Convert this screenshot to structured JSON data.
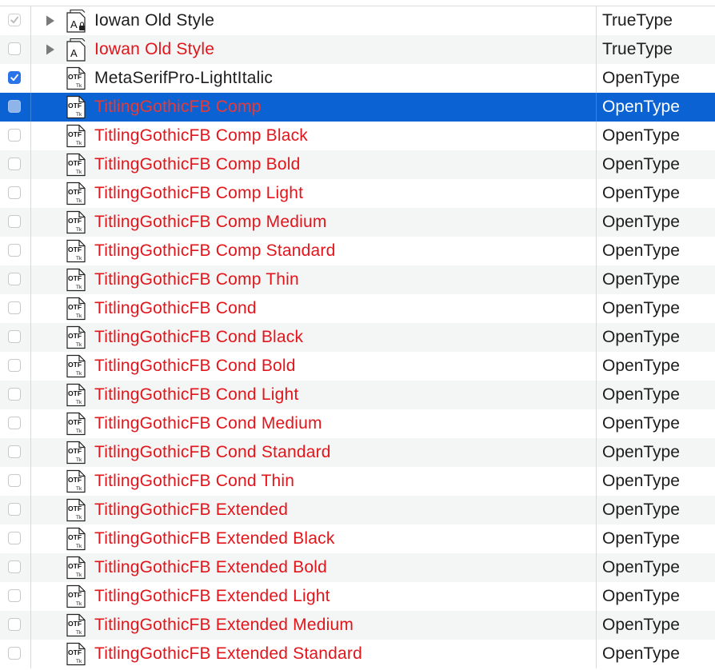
{
  "colors": {
    "missing_font_text": "#e2151b",
    "normal_text": "#1d1d1d",
    "selection": "#0b63d3",
    "checkbox_checked": "#2a73e8",
    "row_alternate": "#f4f5f5"
  },
  "rows": [
    {
      "name": "Iowan Old Style",
      "kind": "TrueType",
      "name_color": "black",
      "checkbox": "checked-disabled",
      "icon": "font-collection-locked-icon",
      "disclosure": true,
      "selected": false
    },
    {
      "name": "Iowan Old Style",
      "kind": "TrueType",
      "name_color": "red",
      "checkbox": "unchecked",
      "icon": "font-collection-icon",
      "disclosure": true,
      "selected": false
    },
    {
      "name": "MetaSerifPro-LightItalic",
      "kind": "OpenType",
      "name_color": "black",
      "checkbox": "checked",
      "icon": "otf-file-icon",
      "disclosure": false,
      "selected": false
    },
    {
      "name": "TitlingGothicFB Comp",
      "kind": "OpenType",
      "name_color": "red",
      "checkbox": "selected",
      "icon": "otf-file-icon",
      "disclosure": false,
      "selected": true
    },
    {
      "name": "TitlingGothicFB Comp Black",
      "kind": "OpenType",
      "name_color": "red",
      "checkbox": "unchecked",
      "icon": "otf-file-icon",
      "disclosure": false,
      "selected": false
    },
    {
      "name": "TitlingGothicFB Comp Bold",
      "kind": "OpenType",
      "name_color": "red",
      "checkbox": "unchecked",
      "icon": "otf-file-icon",
      "disclosure": false,
      "selected": false
    },
    {
      "name": "TitlingGothicFB Comp Light",
      "kind": "OpenType",
      "name_color": "red",
      "checkbox": "unchecked",
      "icon": "otf-file-icon",
      "disclosure": false,
      "selected": false
    },
    {
      "name": "TitlingGothicFB Comp Medium",
      "kind": "OpenType",
      "name_color": "red",
      "checkbox": "unchecked",
      "icon": "otf-file-icon",
      "disclosure": false,
      "selected": false
    },
    {
      "name": "TitlingGothicFB Comp Standard",
      "kind": "OpenType",
      "name_color": "red",
      "checkbox": "unchecked",
      "icon": "otf-file-icon",
      "disclosure": false,
      "selected": false
    },
    {
      "name": "TitlingGothicFB Comp Thin",
      "kind": "OpenType",
      "name_color": "red",
      "checkbox": "unchecked",
      "icon": "otf-file-icon",
      "disclosure": false,
      "selected": false
    },
    {
      "name": "TitlingGothicFB Cond",
      "kind": "OpenType",
      "name_color": "red",
      "checkbox": "unchecked",
      "icon": "otf-file-icon",
      "disclosure": false,
      "selected": false
    },
    {
      "name": "TitlingGothicFB Cond Black",
      "kind": "OpenType",
      "name_color": "red",
      "checkbox": "unchecked",
      "icon": "otf-file-icon",
      "disclosure": false,
      "selected": false
    },
    {
      "name": "TitlingGothicFB Cond Bold",
      "kind": "OpenType",
      "name_color": "red",
      "checkbox": "unchecked",
      "icon": "otf-file-icon",
      "disclosure": false,
      "selected": false
    },
    {
      "name": "TitlingGothicFB Cond Light",
      "kind": "OpenType",
      "name_color": "red",
      "checkbox": "unchecked",
      "icon": "otf-file-icon",
      "disclosure": false,
      "selected": false
    },
    {
      "name": "TitlingGothicFB Cond Medium",
      "kind": "OpenType",
      "name_color": "red",
      "checkbox": "unchecked",
      "icon": "otf-file-icon",
      "disclosure": false,
      "selected": false
    },
    {
      "name": "TitlingGothicFB Cond Standard",
      "kind": "OpenType",
      "name_color": "red",
      "checkbox": "unchecked",
      "icon": "otf-file-icon",
      "disclosure": false,
      "selected": false
    },
    {
      "name": "TitlingGothicFB Cond Thin",
      "kind": "OpenType",
      "name_color": "red",
      "checkbox": "unchecked",
      "icon": "otf-file-icon",
      "disclosure": false,
      "selected": false
    },
    {
      "name": "TitlingGothicFB Extended",
      "kind": "OpenType",
      "name_color": "red",
      "checkbox": "unchecked",
      "icon": "otf-file-icon",
      "disclosure": false,
      "selected": false
    },
    {
      "name": "TitlingGothicFB Extended Black",
      "kind": "OpenType",
      "name_color": "red",
      "checkbox": "unchecked",
      "icon": "otf-file-icon",
      "disclosure": false,
      "selected": false
    },
    {
      "name": "TitlingGothicFB Extended Bold",
      "kind": "OpenType",
      "name_color": "red",
      "checkbox": "unchecked",
      "icon": "otf-file-icon",
      "disclosure": false,
      "selected": false
    },
    {
      "name": "TitlingGothicFB Extended Light",
      "kind": "OpenType",
      "name_color": "red",
      "checkbox": "unchecked",
      "icon": "otf-file-icon",
      "disclosure": false,
      "selected": false
    },
    {
      "name": "TitlingGothicFB Extended Medium",
      "kind": "OpenType",
      "name_color": "red",
      "checkbox": "unchecked",
      "icon": "otf-file-icon",
      "disclosure": false,
      "selected": false
    },
    {
      "name": "TitlingGothicFB Extended Standard",
      "kind": "OpenType",
      "name_color": "red",
      "checkbox": "unchecked",
      "icon": "otf-file-icon",
      "disclosure": false,
      "selected": false
    }
  ]
}
